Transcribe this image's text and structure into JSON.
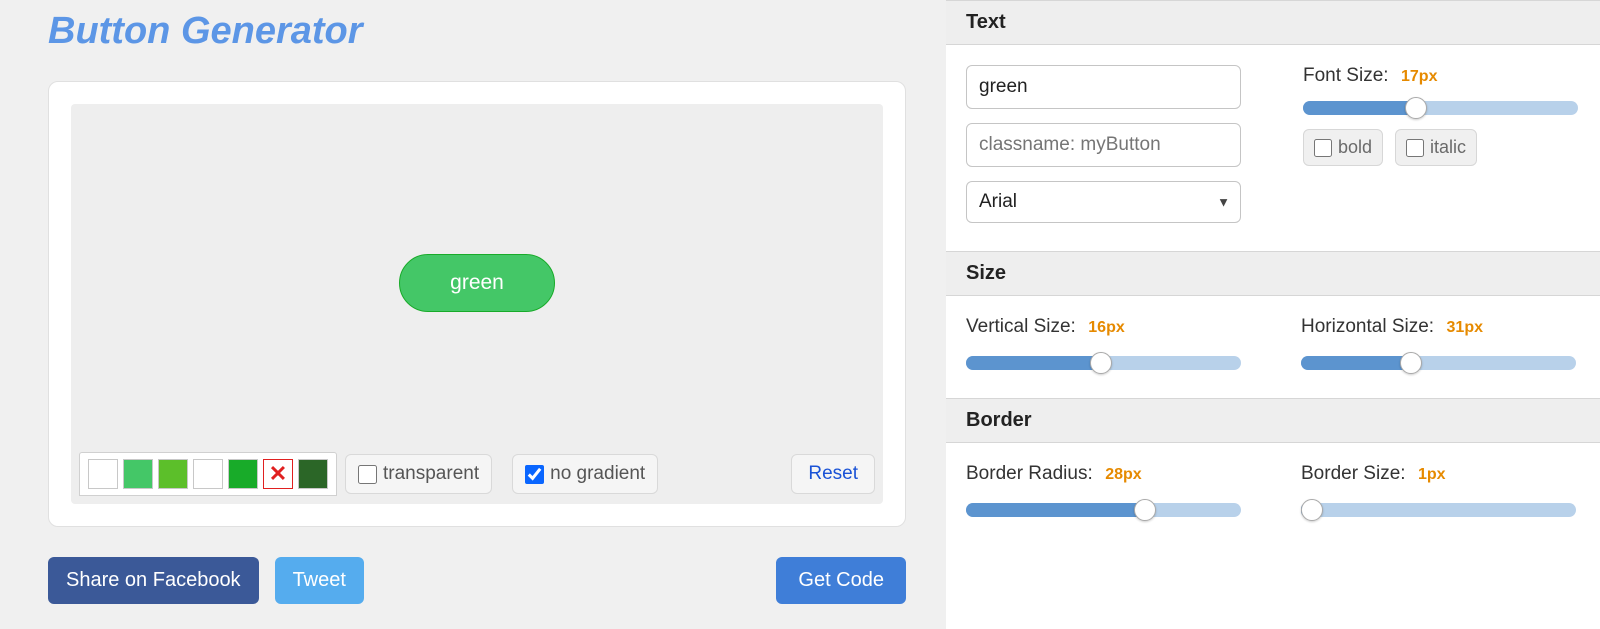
{
  "title": "Button Generator",
  "preview": {
    "button_text": "green"
  },
  "swatches": [
    {
      "color": "#ffffff"
    },
    {
      "color": "#44c767"
    },
    {
      "color": "#5cbf2a"
    },
    {
      "color": "#ffffff"
    },
    {
      "color": "#18ab29"
    },
    {
      "color": "none"
    },
    {
      "color": "#2b6627"
    }
  ],
  "options": {
    "transparent_label": "transparent",
    "transparent_checked": false,
    "nogradient_label": "no gradient",
    "nogradient_checked": true,
    "reset_label": "Reset"
  },
  "share": {
    "facebook": "Share on Facebook",
    "tweet": "Tweet",
    "getcode": "Get Code"
  },
  "sections": {
    "text": {
      "heading": "Text",
      "text_value": "green",
      "classname_placeholder": "classname: myButton",
      "font_family": "Arial",
      "font_size_label": "Font Size:",
      "font_size_value": "17px",
      "font_size_pct": 41,
      "bold_label": "bold",
      "italic_label": "italic"
    },
    "size": {
      "heading": "Size",
      "vertical_label": "Vertical Size:",
      "vertical_value": "16px",
      "vertical_pct": 49,
      "horizontal_label": "Horizontal Size:",
      "horizontal_value": "31px",
      "horizontal_pct": 40
    },
    "border": {
      "heading": "Border",
      "radius_label": "Border Radius:",
      "radius_value": "28px",
      "radius_pct": 65,
      "size_label": "Border Size:",
      "size_value": "1px",
      "size_pct": 4
    }
  }
}
